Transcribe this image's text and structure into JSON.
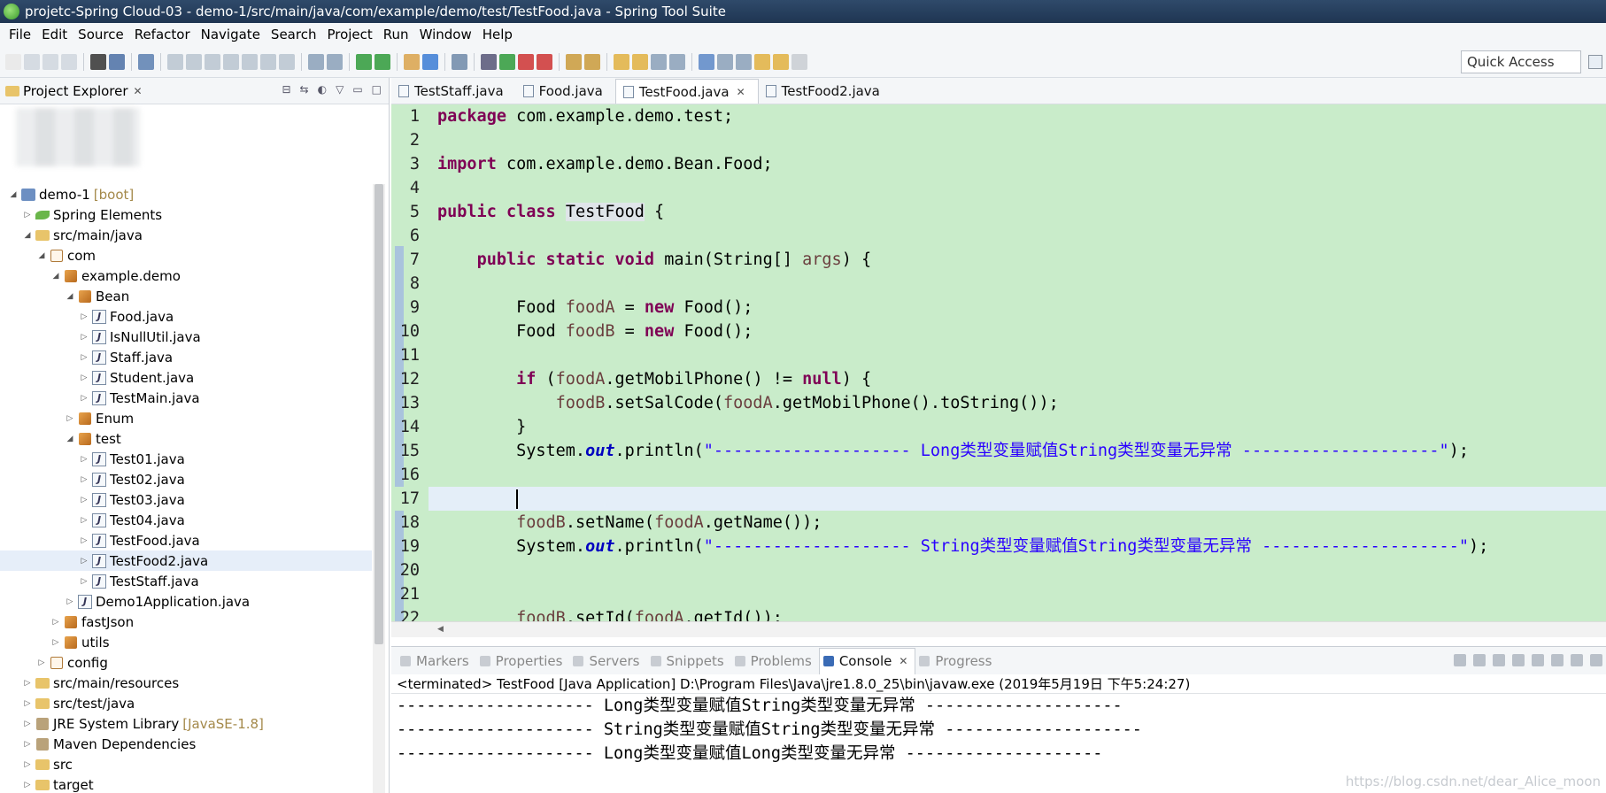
{
  "window": {
    "title": "projetc-Spring Cloud-03 - demo-1/src/main/java/com/example/demo/test/TestFood.java - Spring Tool Suite"
  },
  "menu": [
    "File",
    "Edit",
    "Source",
    "Refactor",
    "Navigate",
    "Search",
    "Project",
    "Run",
    "Window",
    "Help"
  ],
  "toolbar": {
    "quick_access": "Quick Access"
  },
  "explorer": {
    "title": "Project Explorer",
    "tree": [
      {
        "depth": 0,
        "expanded": "open",
        "icon": "proj",
        "label": "demo-1",
        "decoration": "[boot]"
      },
      {
        "depth": 1,
        "expanded": "closed",
        "icon": "leaf",
        "label": "Spring Elements"
      },
      {
        "depth": 1,
        "expanded": "open",
        "icon": "pkgroot",
        "label": "src/main/java"
      },
      {
        "depth": 2,
        "expanded": "open",
        "icon": "pkg-e",
        "label": "com"
      },
      {
        "depth": 3,
        "expanded": "open",
        "icon": "pkg",
        "label": "example.demo"
      },
      {
        "depth": 4,
        "expanded": "open",
        "icon": "pkg",
        "label": "Bean"
      },
      {
        "depth": 5,
        "expanded": "closed",
        "icon": "java",
        "label": "Food.java"
      },
      {
        "depth": 5,
        "expanded": "closed",
        "icon": "java",
        "label": "IsNullUtil.java"
      },
      {
        "depth": 5,
        "expanded": "closed",
        "icon": "java",
        "label": "Staff.java"
      },
      {
        "depth": 5,
        "expanded": "closed",
        "icon": "java",
        "label": "Student.java"
      },
      {
        "depth": 5,
        "expanded": "closed",
        "icon": "java",
        "label": "TestMain.java"
      },
      {
        "depth": 4,
        "expanded": "closed",
        "icon": "pkg",
        "label": "Enum"
      },
      {
        "depth": 4,
        "expanded": "open",
        "icon": "pkg",
        "label": "test"
      },
      {
        "depth": 5,
        "expanded": "closed",
        "icon": "java",
        "label": "Test01.java"
      },
      {
        "depth": 5,
        "expanded": "closed",
        "icon": "java",
        "label": "Test02.java"
      },
      {
        "depth": 5,
        "expanded": "closed",
        "icon": "java",
        "label": "Test03.java"
      },
      {
        "depth": 5,
        "expanded": "closed",
        "icon": "java",
        "label": "Test04.java"
      },
      {
        "depth": 5,
        "expanded": "closed",
        "icon": "java",
        "label": "TestFood.java"
      },
      {
        "depth": 5,
        "expanded": "closed",
        "icon": "java",
        "label": "TestFood2.java",
        "selected": true
      },
      {
        "depth": 5,
        "expanded": "closed",
        "icon": "java",
        "label": "TestStaff.java"
      },
      {
        "depth": 4,
        "expanded": "closed",
        "icon": "java",
        "label": "Demo1Application.java"
      },
      {
        "depth": 3,
        "expanded": "closed",
        "icon": "pkg",
        "label": "fastJson"
      },
      {
        "depth": 3,
        "expanded": "closed",
        "icon": "pkg",
        "label": "utils"
      },
      {
        "depth": 2,
        "expanded": "closed",
        "icon": "pkg-e",
        "label": "config"
      },
      {
        "depth": 1,
        "expanded": "closed",
        "icon": "pkgroot",
        "label": "src/main/resources"
      },
      {
        "depth": 1,
        "expanded": "closed",
        "icon": "pkgroot",
        "label": "src/test/java"
      },
      {
        "depth": 1,
        "expanded": "closed",
        "icon": "lib",
        "label": "JRE System Library",
        "decoration": "[JavaSE-1.8]"
      },
      {
        "depth": 1,
        "expanded": "closed",
        "icon": "lib",
        "label": "Maven Dependencies"
      },
      {
        "depth": 1,
        "expanded": "closed",
        "icon": "folder",
        "label": "src"
      },
      {
        "depth": 1,
        "expanded": "closed",
        "icon": "folder",
        "label": "target"
      }
    ]
  },
  "editor": {
    "tabs": [
      {
        "label": "TestStaff.java",
        "active": false
      },
      {
        "label": "Food.java",
        "active": false
      },
      {
        "label": "TestFood.java",
        "active": true
      },
      {
        "label": "TestFood2.java",
        "active": false
      }
    ],
    "current_line": 17,
    "lines": [
      {
        "n": "1",
        "tokens": [
          [
            "kw",
            "package"
          ],
          [
            "t",
            " com.example.demo.test;"
          ]
        ]
      },
      {
        "n": "2",
        "tokens": []
      },
      {
        "n": "3",
        "tokens": [
          [
            "kw",
            "import"
          ],
          [
            "t",
            " com.example.demo.Bean.Food;"
          ]
        ]
      },
      {
        "n": "4",
        "tokens": []
      },
      {
        "n": "5",
        "tokens": [
          [
            "kw",
            "public"
          ],
          [
            "t",
            " "
          ],
          [
            "kw",
            "class"
          ],
          [
            "t",
            " "
          ],
          [
            "hl",
            "TestFood"
          ],
          [
            "t",
            " {"
          ]
        ]
      },
      {
        "n": "6",
        "tokens": []
      },
      {
        "n": "7",
        "tokens": [
          [
            "t",
            "    "
          ],
          [
            "kw",
            "public"
          ],
          [
            "t",
            " "
          ],
          [
            "kw",
            "static"
          ],
          [
            "t",
            " "
          ],
          [
            "kw",
            "void"
          ],
          [
            "t",
            " main(String[] "
          ],
          [
            "fld",
            "args"
          ],
          [
            "t",
            ") {"
          ]
        ]
      },
      {
        "n": "8",
        "tokens": []
      },
      {
        "n": "9",
        "tokens": [
          [
            "t",
            "        Food "
          ],
          [
            "fld",
            "foodA"
          ],
          [
            "t",
            " = "
          ],
          [
            "kw",
            "new"
          ],
          [
            "t",
            " Food();"
          ]
        ]
      },
      {
        "n": "10",
        "tokens": [
          [
            "t",
            "        Food "
          ],
          [
            "fld",
            "foodB"
          ],
          [
            "t",
            " = "
          ],
          [
            "kw",
            "new"
          ],
          [
            "t",
            " Food();"
          ]
        ]
      },
      {
        "n": "11",
        "tokens": []
      },
      {
        "n": "12",
        "tokens": [
          [
            "t",
            "        "
          ],
          [
            "kw",
            "if"
          ],
          [
            "t",
            " ("
          ],
          [
            "fld",
            "foodA"
          ],
          [
            "t",
            ".getMobilPhone() != "
          ],
          [
            "kw",
            "null"
          ],
          [
            "t",
            ") {"
          ]
        ]
      },
      {
        "n": "13",
        "tokens": [
          [
            "t",
            "            "
          ],
          [
            "fld",
            "foodB"
          ],
          [
            "t",
            ".setSalCode("
          ],
          [
            "fld",
            "foodA"
          ],
          [
            "t",
            ".getMobilPhone().toString());"
          ]
        ]
      },
      {
        "n": "14",
        "tokens": [
          [
            "t",
            "        }"
          ]
        ]
      },
      {
        "n": "15",
        "tokens": [
          [
            "t",
            "        System."
          ],
          [
            "sta",
            "out"
          ],
          [
            "t",
            ".println("
          ],
          [
            "st",
            "\"-------------------- Long类型变量赋值String类型变量无异常 --------------------\""
          ],
          [
            "t",
            ");"
          ]
        ]
      },
      {
        "n": "16",
        "tokens": []
      },
      {
        "n": "17",
        "tokens": [
          [
            "t",
            "        "
          ],
          [
            "caret",
            ""
          ]
        ]
      },
      {
        "n": "18",
        "tokens": [
          [
            "t",
            "        "
          ],
          [
            "fld",
            "foodB"
          ],
          [
            "t",
            ".setName("
          ],
          [
            "fld",
            "foodA"
          ],
          [
            "t",
            ".getName());"
          ]
        ]
      },
      {
        "n": "19",
        "tokens": [
          [
            "t",
            "        System."
          ],
          [
            "sta",
            "out"
          ],
          [
            "t",
            ".println("
          ],
          [
            "st",
            "\"-------------------- String类型变量赋值String类型变量无异常 --------------------\""
          ],
          [
            "t",
            ");"
          ]
        ]
      },
      {
        "n": "20",
        "tokens": []
      },
      {
        "n": "21",
        "tokens": []
      },
      {
        "n": "22",
        "tokens": [
          [
            "t",
            "        "
          ],
          [
            "fld",
            "foodB"
          ],
          [
            "t",
            ".setId("
          ],
          [
            "fld",
            "foodA"
          ],
          [
            "t",
            ".getId());"
          ]
        ]
      }
    ]
  },
  "console": {
    "tabs": [
      {
        "label": "Markers",
        "active": false
      },
      {
        "label": "Properties",
        "active": false
      },
      {
        "label": "Servers",
        "active": false
      },
      {
        "label": "Snippets",
        "active": false
      },
      {
        "label": "Problems",
        "active": false
      },
      {
        "label": "Console",
        "active": true
      },
      {
        "label": "Progress",
        "active": false
      }
    ],
    "status": "<terminated> TestFood [Java Application] D:\\Program Files\\Java\\jre1.8.0_25\\bin\\javaw.exe (2019年5月19日 下午5:24:27)",
    "output": [
      "-------------------- Long类型变量赋值String类型变量无异常 --------------------",
      "-------------------- String类型变量赋值String类型变量无异常 --------------------",
      "-------------------- Long类型变量赋值Long类型变量无异常 --------------------"
    ],
    "watermark": "https://blog.csdn.net/dear_Alice_moon"
  },
  "colors": {
    "editor_bg": "#c9ecca",
    "keyword": "#7f0055",
    "string": "#2a00ff",
    "field": "#6a3e3e",
    "static_field": "#0000c0"
  }
}
